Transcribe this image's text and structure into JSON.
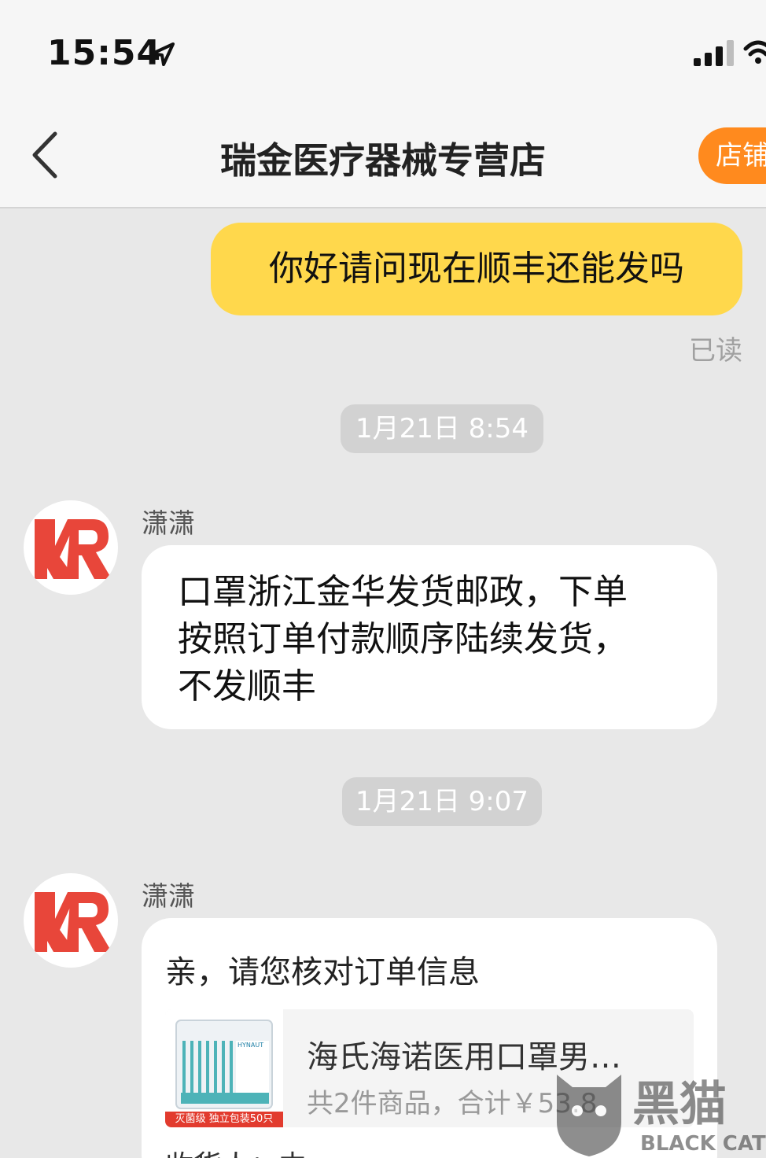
{
  "status_bar": {
    "time": "15:54"
  },
  "nav": {
    "title": "瑞金医疗器械专营店",
    "shop_button": "店铺"
  },
  "messages": {
    "outgoing_1": "你好请问现在顺丰还能发吗",
    "read_status": "已读",
    "timestamp_1": "1月21日 8:54",
    "sender_1": "潇潇",
    "incoming_1_lines": [
      "口罩浙江金华发货邮政，下单",
      "按照订单付款顺序陆续发货，",
      "不发顺丰"
    ],
    "timestamp_2": "1月21日 9:07",
    "sender_2": "潇潇"
  },
  "order_card": {
    "title": "亲，请您核对订单信息",
    "product_name": "海氏海诺医用口罩男…",
    "product_meta": "共2件商品，合计￥53.8",
    "thumb_badge": "灭菌级 独立包装50只",
    "thumb_brand": "HYNAUT",
    "partial_next_line": "收货人：中"
  },
  "watermark": {
    "cn": "黑猫",
    "en": "BLACK CAT"
  },
  "colors": {
    "accent_yellow": "#ffd84c",
    "shop_orange": "#ff8a1e",
    "avatar_red": "#e8463a"
  },
  "icons": [
    "location-arrow-icon",
    "signal-icon",
    "wifi-icon",
    "back-chevron-icon",
    "avatar-logo-icon",
    "black-cat-watermark"
  ]
}
